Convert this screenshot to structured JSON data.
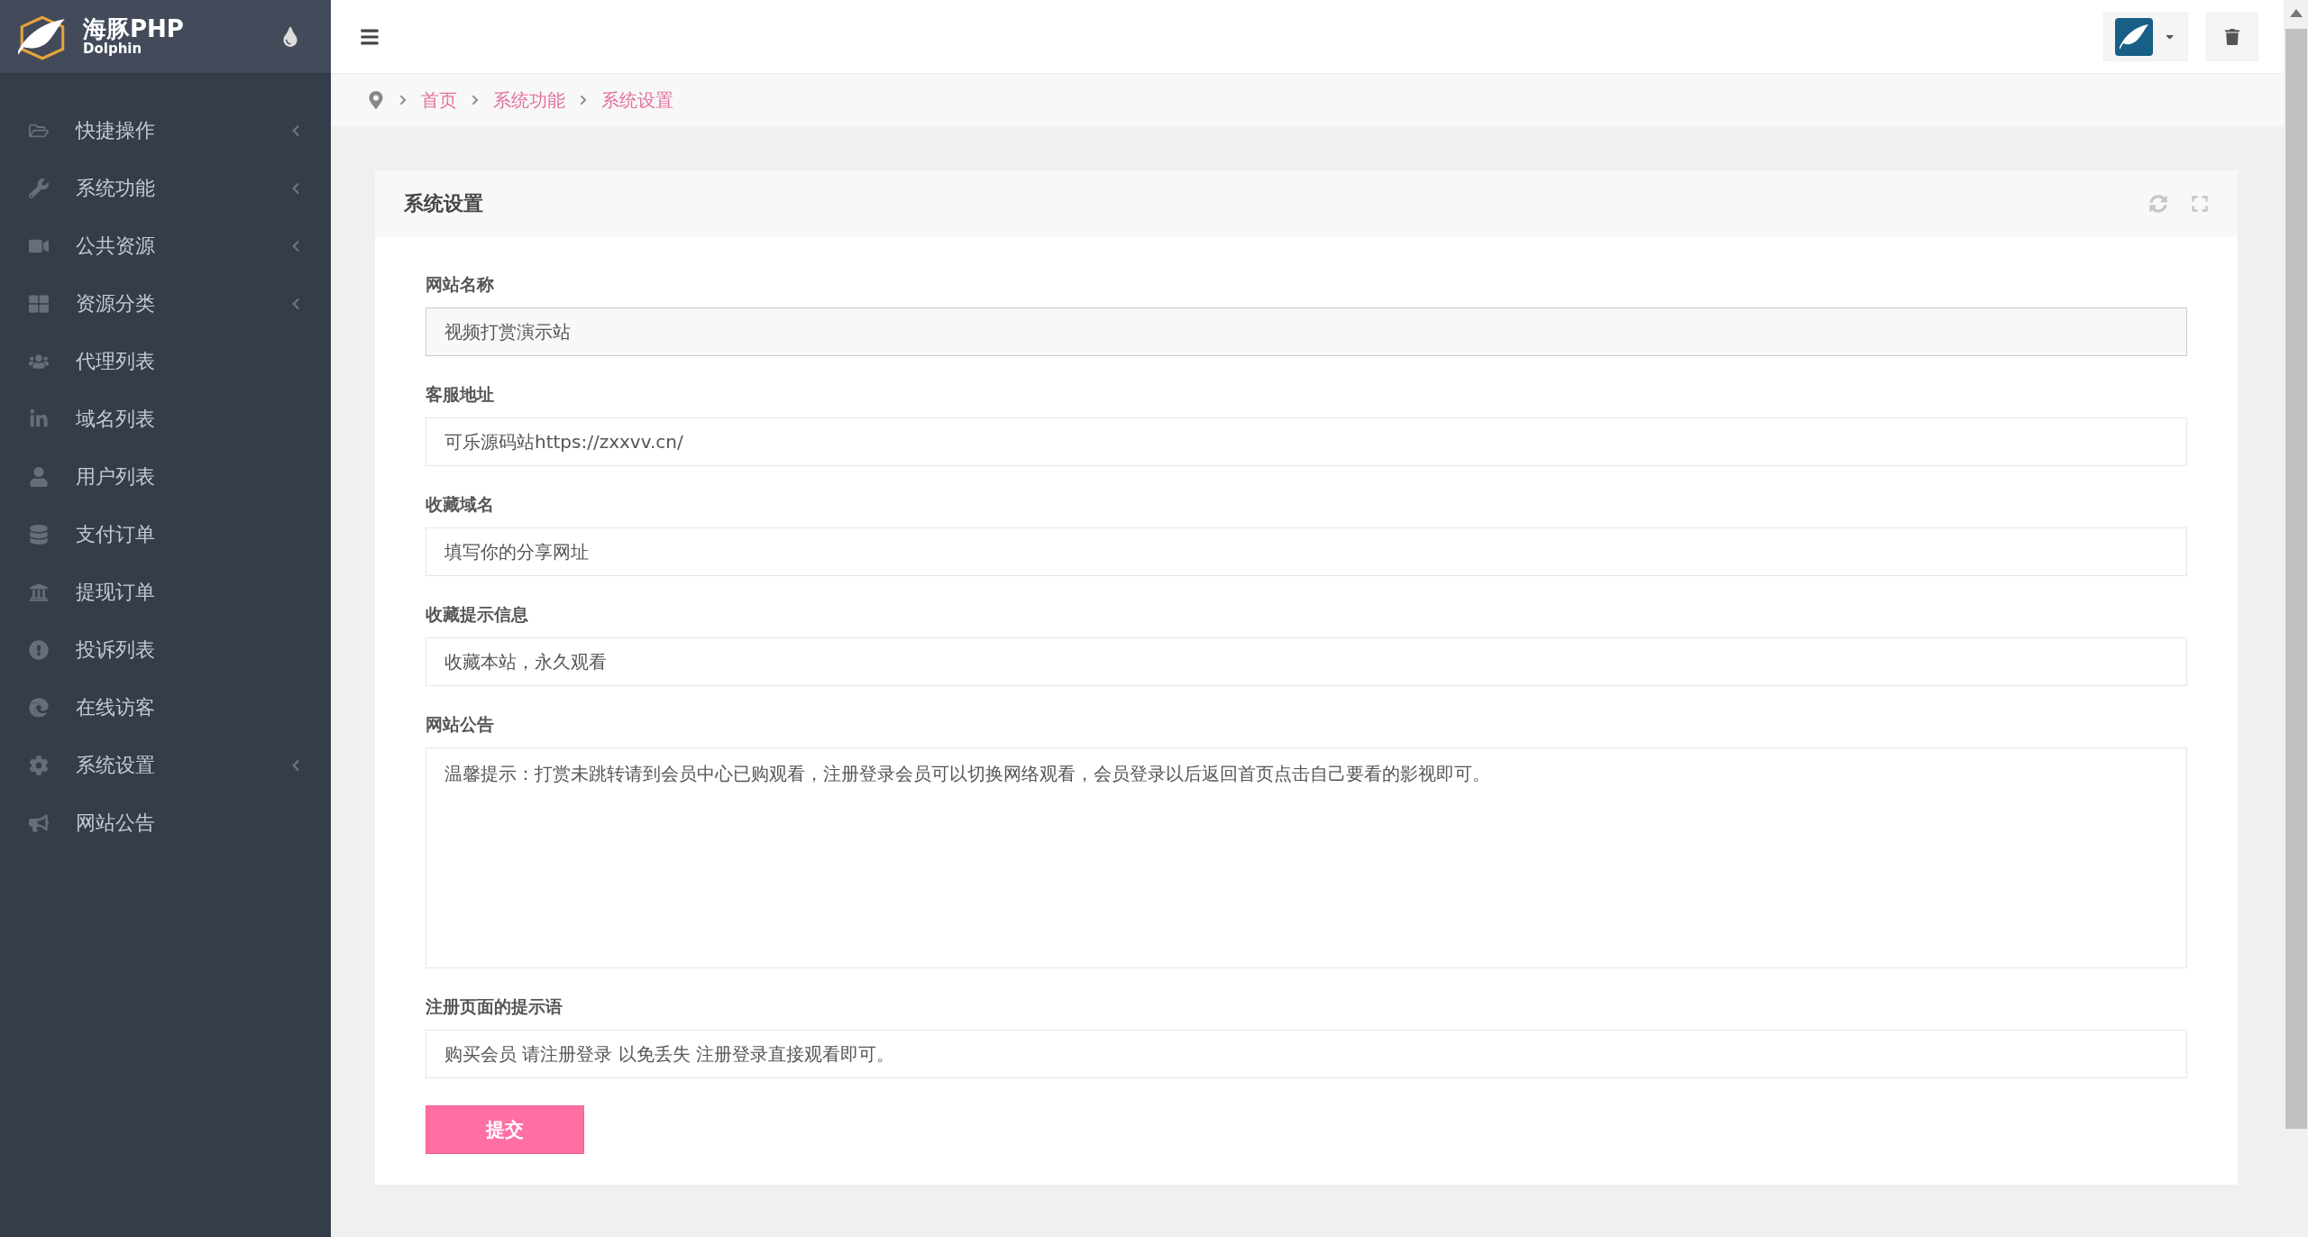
{
  "logo": {
    "name": "海豚PHP",
    "subtitle": "Dolphin"
  },
  "sidebar": {
    "items": [
      {
        "label": "快捷操作",
        "expandable": true
      },
      {
        "label": "系统功能",
        "expandable": true
      },
      {
        "label": "公共资源",
        "expandable": true
      },
      {
        "label": "资源分类",
        "expandable": true
      },
      {
        "label": "代理列表",
        "expandable": false
      },
      {
        "label": "域名列表",
        "expandable": false
      },
      {
        "label": "用户列表",
        "expandable": false
      },
      {
        "label": "支付订单",
        "expandable": false
      },
      {
        "label": "提现订单",
        "expandable": false
      },
      {
        "label": "投诉列表",
        "expandable": false
      },
      {
        "label": "在线访客",
        "expandable": false
      },
      {
        "label": "系统设置",
        "expandable": true
      },
      {
        "label": "网站公告",
        "expandable": false
      }
    ]
  },
  "breadcrumb": [
    "首页",
    "系统功能",
    "系统设置"
  ],
  "panel": {
    "title": "系统设置",
    "fields": [
      {
        "label": "网站名称",
        "kind": "input",
        "value": "视频打赏演示站",
        "focused": true
      },
      {
        "label": "客服地址",
        "kind": "input",
        "value": "可乐源码站https://zxxvv.cn/",
        "focused": false
      },
      {
        "label": "收藏域名",
        "kind": "input",
        "value": "填写你的分享网址",
        "focused": false
      },
      {
        "label": "收藏提示信息",
        "kind": "input",
        "value": "收藏本站，永久观看",
        "focused": false
      },
      {
        "label": "网站公告",
        "kind": "textarea",
        "value": "温馨提示：打赏未跳转请到会员中心已购观看，注册登录会员可以切换网络观看，会员登录以后返回首页点击自己要看的影视即可。",
        "focused": false
      },
      {
        "label": "注册页面的提示语",
        "kind": "input",
        "value": "购买会员 请注册登录 以免丢失 注册登录直接观看即可。",
        "focused": false
      }
    ],
    "submit": "提交"
  }
}
